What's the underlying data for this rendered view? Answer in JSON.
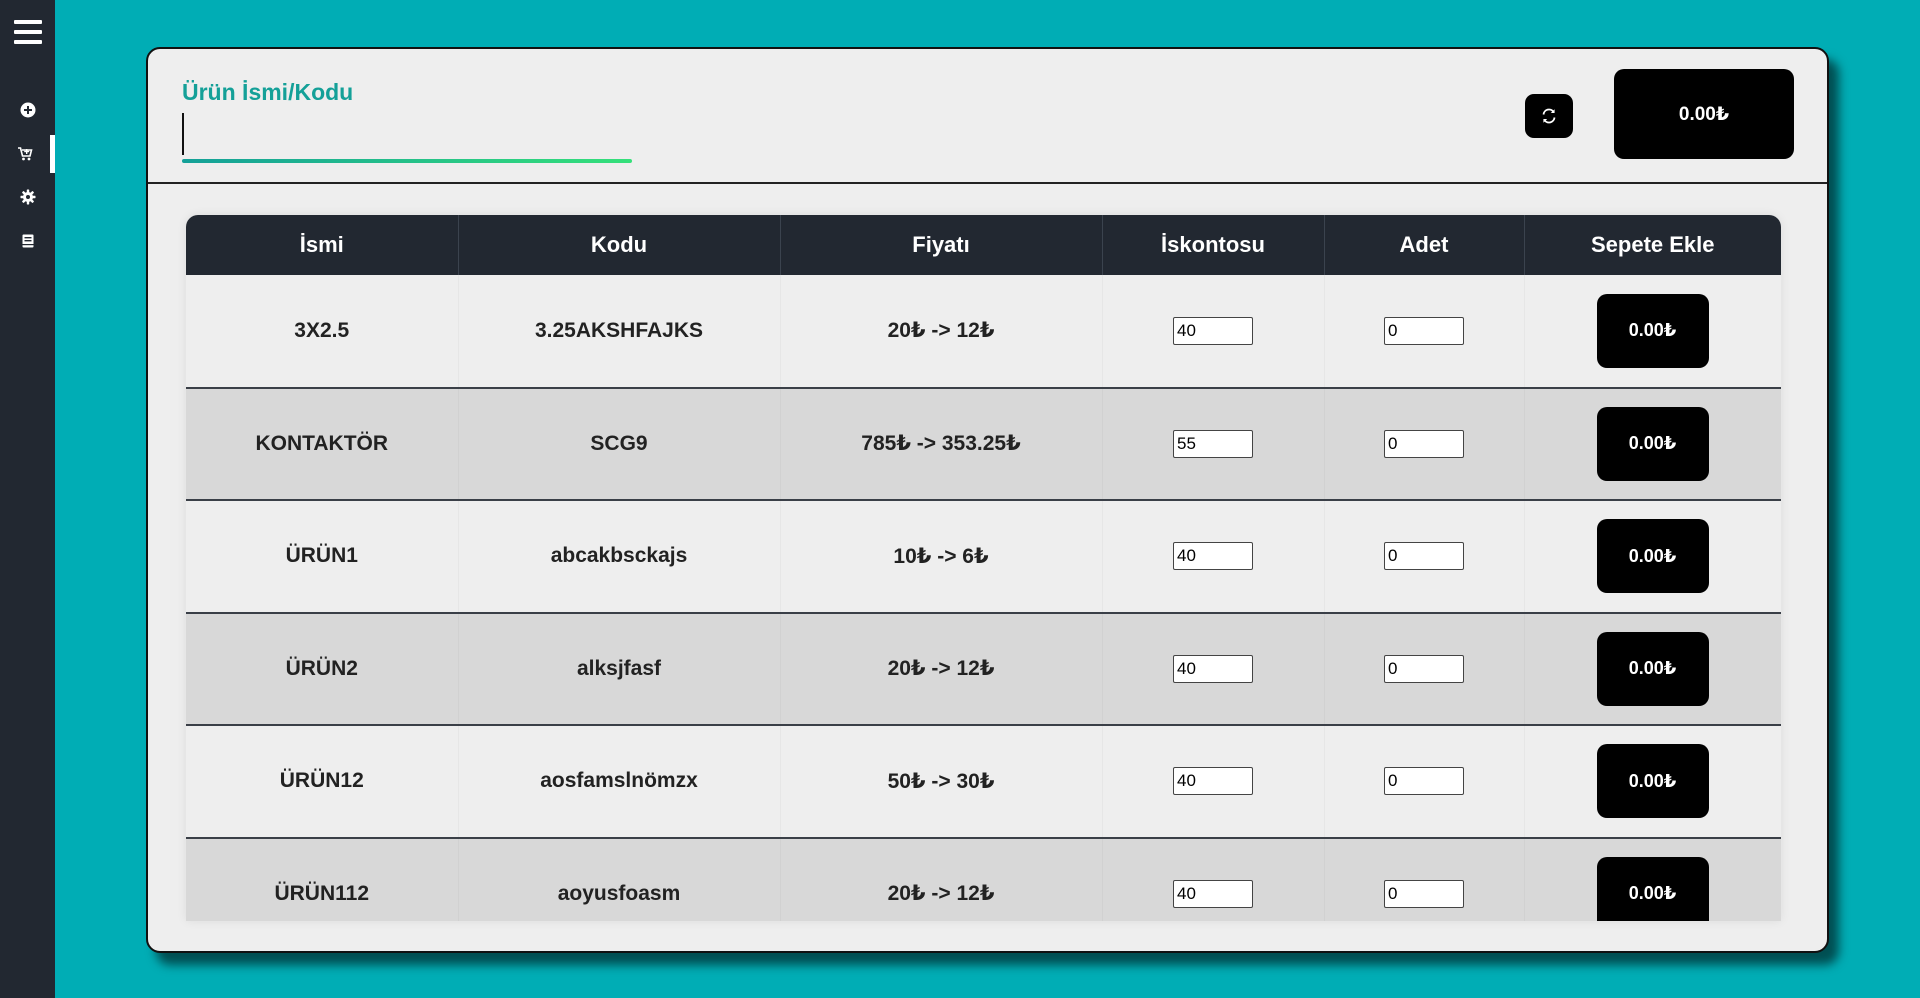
{
  "sidebar": {
    "items": [
      {
        "icon": "plus-circle-icon",
        "active": false
      },
      {
        "icon": "cart-icon",
        "active": true
      },
      {
        "icon": "gear-icon",
        "active": false
      },
      {
        "icon": "book-icon",
        "active": false
      }
    ]
  },
  "header": {
    "search_label": "Ürün İsmi/Kodu",
    "search_value": "",
    "total": "0.00₺"
  },
  "table": {
    "columns": [
      "İsmi",
      "Kodu",
      "Fiyatı",
      "İskontosu",
      "Adet",
      "Sepete Ekle"
    ],
    "rows": [
      {
        "name": "3X2.5",
        "code": "3.25AKSHFAJKS",
        "price": "20₺ -> 12₺",
        "discount": "40",
        "qty": "0",
        "add": "0.00₺"
      },
      {
        "name": "KONTAKTÖR",
        "code": "SCG9",
        "price": "785₺ -> 353.25₺",
        "discount": "55",
        "qty": "0",
        "add": "0.00₺"
      },
      {
        "name": "ÜRÜN1",
        "code": "abcakbsckajs",
        "price": "10₺ -> 6₺",
        "discount": "40",
        "qty": "0",
        "add": "0.00₺"
      },
      {
        "name": "ÜRÜN2",
        "code": "alksjfasf",
        "price": "20₺ -> 12₺",
        "discount": "40",
        "qty": "0",
        "add": "0.00₺"
      },
      {
        "name": "ÜRÜN12",
        "code": "aosfamslnömzx",
        "price": "50₺ -> 30₺",
        "discount": "40",
        "qty": "0",
        "add": "0.00₺"
      },
      {
        "name": "ÜRÜN112",
        "code": "aoyusfoasm",
        "price": "20₺ -> 12₺",
        "discount": "40",
        "qty": "0",
        "add": "0.00₺"
      }
    ]
  },
  "colors": {
    "background": "#00adb5",
    "sidebar": "#222831",
    "accent": "#14a098",
    "panel": "#eeeeee"
  }
}
